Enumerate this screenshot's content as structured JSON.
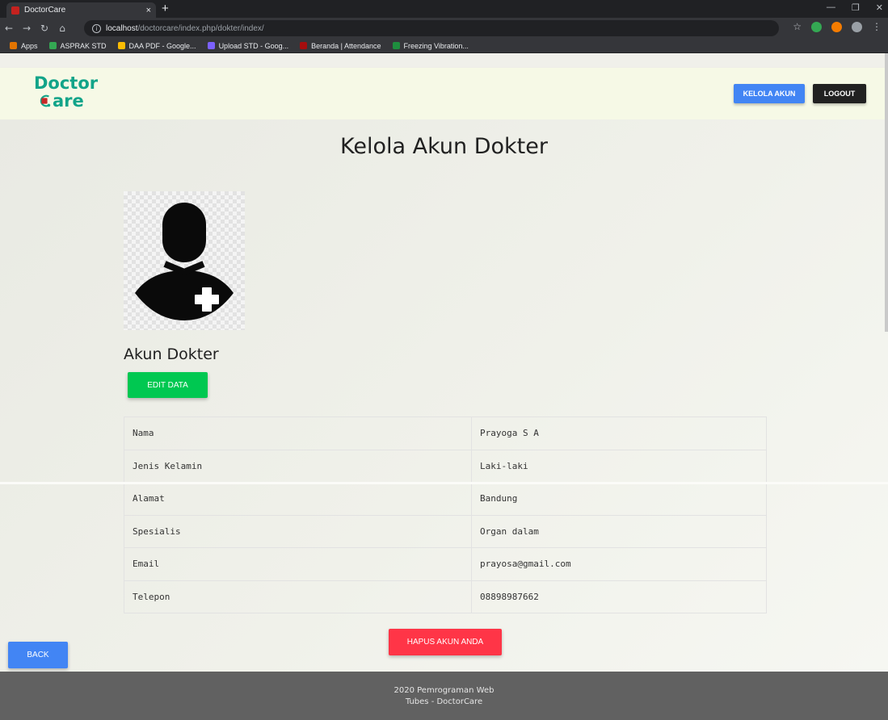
{
  "browser": {
    "tab_title": "DoctorCare",
    "tab_close": "×",
    "new_tab": "+",
    "url_host": "localhost",
    "url_path": "/doctorcare/index.php/dokter/index/",
    "bookmarks": [
      {
        "label": "Apps",
        "color": "#e37400"
      },
      {
        "label": "ASPRAK STD",
        "color": "#34a853"
      },
      {
        "label": "DAA PDF - Google...",
        "color": "#fbbc04"
      },
      {
        "label": "Upload STD - Goog...",
        "color": "#7b61ff"
      },
      {
        "label": "Beranda | Attendance",
        "color": "#a50e0e"
      },
      {
        "label": "Freezing Vibration...",
        "color": "#1e8e3e"
      }
    ]
  },
  "header": {
    "logo_line1": "Doctor",
    "logo_line2": "are",
    "kelola_label": "KELOLA AKUN",
    "logout_label": "LOGOUT"
  },
  "main": {
    "page_title": "Kelola Akun Dokter",
    "section_title": "Akun Dokter",
    "edit_label": "EDIT DATA",
    "rows": [
      {
        "key": "Nama",
        "value": "Prayoga S A"
      },
      {
        "key": "Jenis Kelamin",
        "value": "Laki-laki"
      },
      {
        "key": "Alamat",
        "value": "Bandung"
      },
      {
        "key": "Spesialis",
        "value": "Organ dalam"
      },
      {
        "key": "Email",
        "value": "prayosa@gmail.com"
      },
      {
        "key": "Telepon",
        "value": "08898987662"
      }
    ],
    "hapus_label": "HAPUS AKUN ANDA",
    "back_label": "BACK"
  },
  "footer": {
    "line1": "2020 Pemrograman Web",
    "line2": "Tubes - DoctorCare"
  },
  "colors": {
    "brand": "#12a489",
    "primary": "#4285f4",
    "success": "#00c851",
    "danger": "#ff3547",
    "dark": "#212121"
  }
}
